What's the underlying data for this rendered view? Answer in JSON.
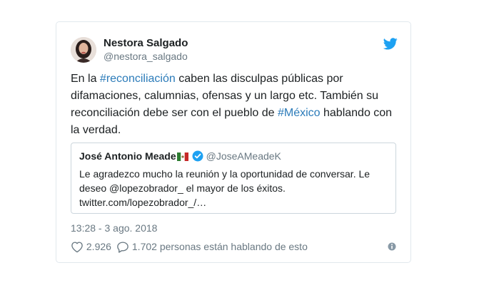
{
  "tweet": {
    "author_name": "Nestora Salgado",
    "author_handle": "@nestora_salgado",
    "text_parts": [
      "En la ",
      "#reconciliación",
      " caben las disculpas públicas por difamaciones, calumnias, ofensas y un largo etc. También su reconciliación debe ser con el pueblo de ",
      "#México",
      " hablando con la verdad."
    ],
    "timestamp": "13:28 - 3 ago. 2018",
    "like_count": "2.926",
    "reply_text": "1.702 personas están hablando de esto"
  },
  "quoted": {
    "author_name": "José Antonio Meade",
    "author_handle": "@JoseAMeadeK",
    "text": "Le agradezco mucho la reunión y la oportunidad de conversar. Le deseo @lopezobrador_ el mayor de los éxitos.",
    "link": "twitter.com/lopezobrador_/…"
  },
  "icons": {
    "brand": "twitter-bird-icon",
    "verified": "verified-badge-icon",
    "like": "heart-icon",
    "reply": "speech-bubble-icon",
    "info": "info-icon",
    "flag": "mexico-flag-icon"
  },
  "colors": {
    "hashtag": "#2b7bb9",
    "twitter_blue": "#1da1f2",
    "muted": "#697882",
    "border": "#e1e8ed"
  }
}
